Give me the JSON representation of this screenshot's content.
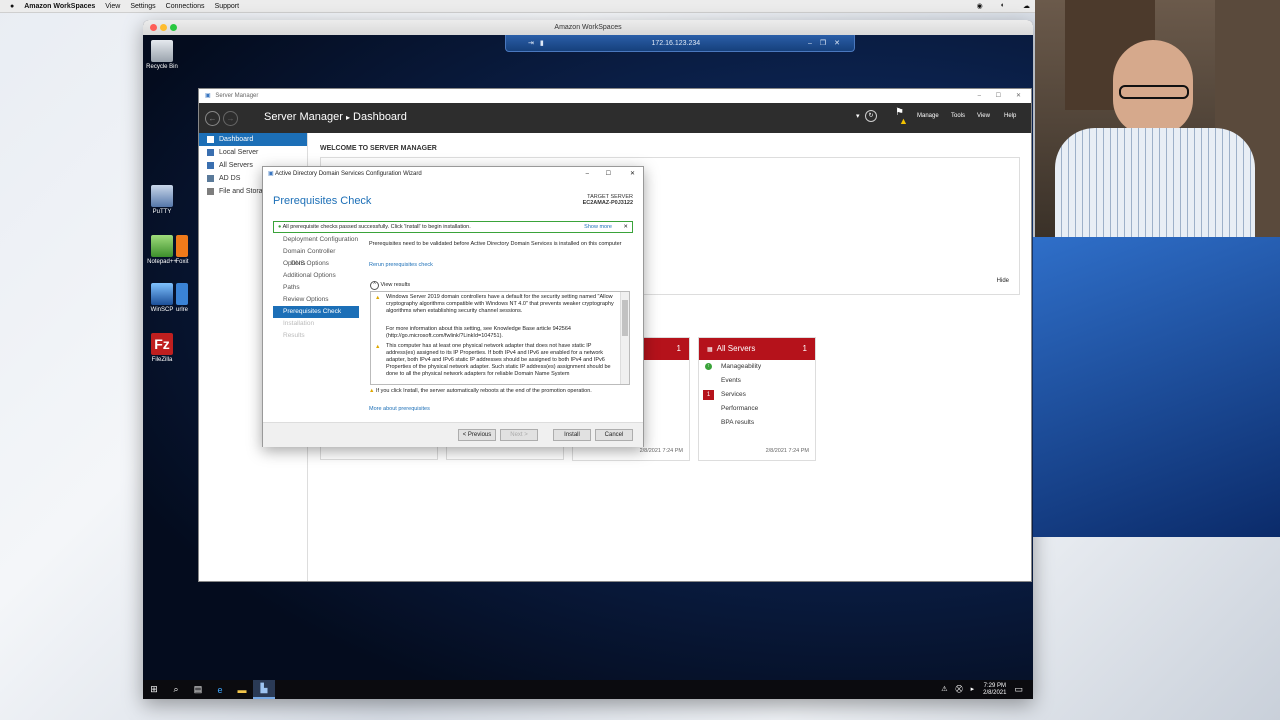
{
  "mac_menubar": {
    "apple": "",
    "app": "Amazon WorkSpaces",
    "items": [
      "View",
      "Settings",
      "Connections",
      "Support"
    ]
  },
  "ws_window": {
    "title": "Amazon WorkSpaces",
    "connection_ip": "172.16.123.234"
  },
  "desktop_icons": [
    {
      "label": "Recycle Bin",
      "icon": "recycle-bin-icon"
    },
    {
      "label": "PuTTY",
      "icon": "putty-icon"
    },
    {
      "label": "Notepad++",
      "icon": "notepad-plus-plus-icon"
    },
    {
      "label": "Foxit",
      "icon": "foxit-icon"
    },
    {
      "label": "WinSCP",
      "icon": "winscp-icon"
    },
    {
      "label": "urlre",
      "icon": "url-icon"
    },
    {
      "label": "FileZilla",
      "icon": "filezilla-icon"
    }
  ],
  "server_manager": {
    "window_title": "Server Manager",
    "breadcrumb_app": "Server Manager",
    "breadcrumb_sep": "▸",
    "breadcrumb_page": "Dashboard",
    "menu": [
      "Manage",
      "Tools",
      "View",
      "Help"
    ],
    "sidebar": [
      "Dashboard",
      "Local Server",
      "All Servers",
      "AD DS",
      "File and Storag"
    ],
    "welcome": "WELCOME TO SERVER MANAGER",
    "hide": "Hide",
    "tiles": [
      {
        "count": "1",
        "timestamp": "2/8/2021 7:24 PM"
      },
      {
        "title": "All Servers",
        "count": "1",
        "rows": [
          "Manageability",
          "Events",
          "Services",
          "Performance",
          "BPA results"
        ],
        "services_badge": "1",
        "timestamp": "2/8/2021 7:24 PM"
      }
    ]
  },
  "wizard": {
    "title": "Active Directory Domain Services Configuration Wizard",
    "heading": "Prerequisites Check",
    "target_label": "TARGET SERVER",
    "target_name": "EC2AMAZ-P0J3122",
    "banner": "All prerequisite checks passed successfully.  Click 'Install' to begin installation.",
    "show_more": "Show more",
    "nav": [
      "Deployment Configuration",
      "Domain Controller Options",
      "DNS Options",
      "Additional Options",
      "Paths",
      "Review Options",
      "Prerequisites Check",
      "Installation",
      "Results"
    ],
    "intro": "Prerequisites need to be validated before Active Directory Domain Services is installed on this computer",
    "rerun": "Rerun prerequisites check",
    "view_results": "View results",
    "warn1": "Windows Server 2019 domain controllers have a default for the security setting named \"Allow cryptography algorithms compatible with Windows NT 4.0\" that prevents weaker cryptography algorithms when establishing security channel sessions.",
    "warn1b": "For more information about this setting, see Knowledge Base article 942564 (http://go.microsoft.com/fwlink/?LinkId=104751).",
    "warn2": "This computer has at least one physical network adapter that does not have static IP address(es) assigned to its IP Properties. If both IPv4 and IPv6 are enabled for a network adapter, both IPv4 and IPv6 static IP addresses should be assigned to both IPv4 and IPv6 Properties of the physical network adapter. Such static IP address(es) assignment should be done to all the physical network adapters for reliable Domain Name System",
    "reboot_note": "If you click Install, the server automatically reboots at the end of the promotion operation.",
    "more_about": "More about prerequisites",
    "btn_prev": "< Previous",
    "btn_next": "Next >",
    "btn_install": "Install",
    "btn_cancel": "Cancel"
  },
  "taskbar": {
    "time": "7:29 PM",
    "date": "2/8/2021"
  }
}
